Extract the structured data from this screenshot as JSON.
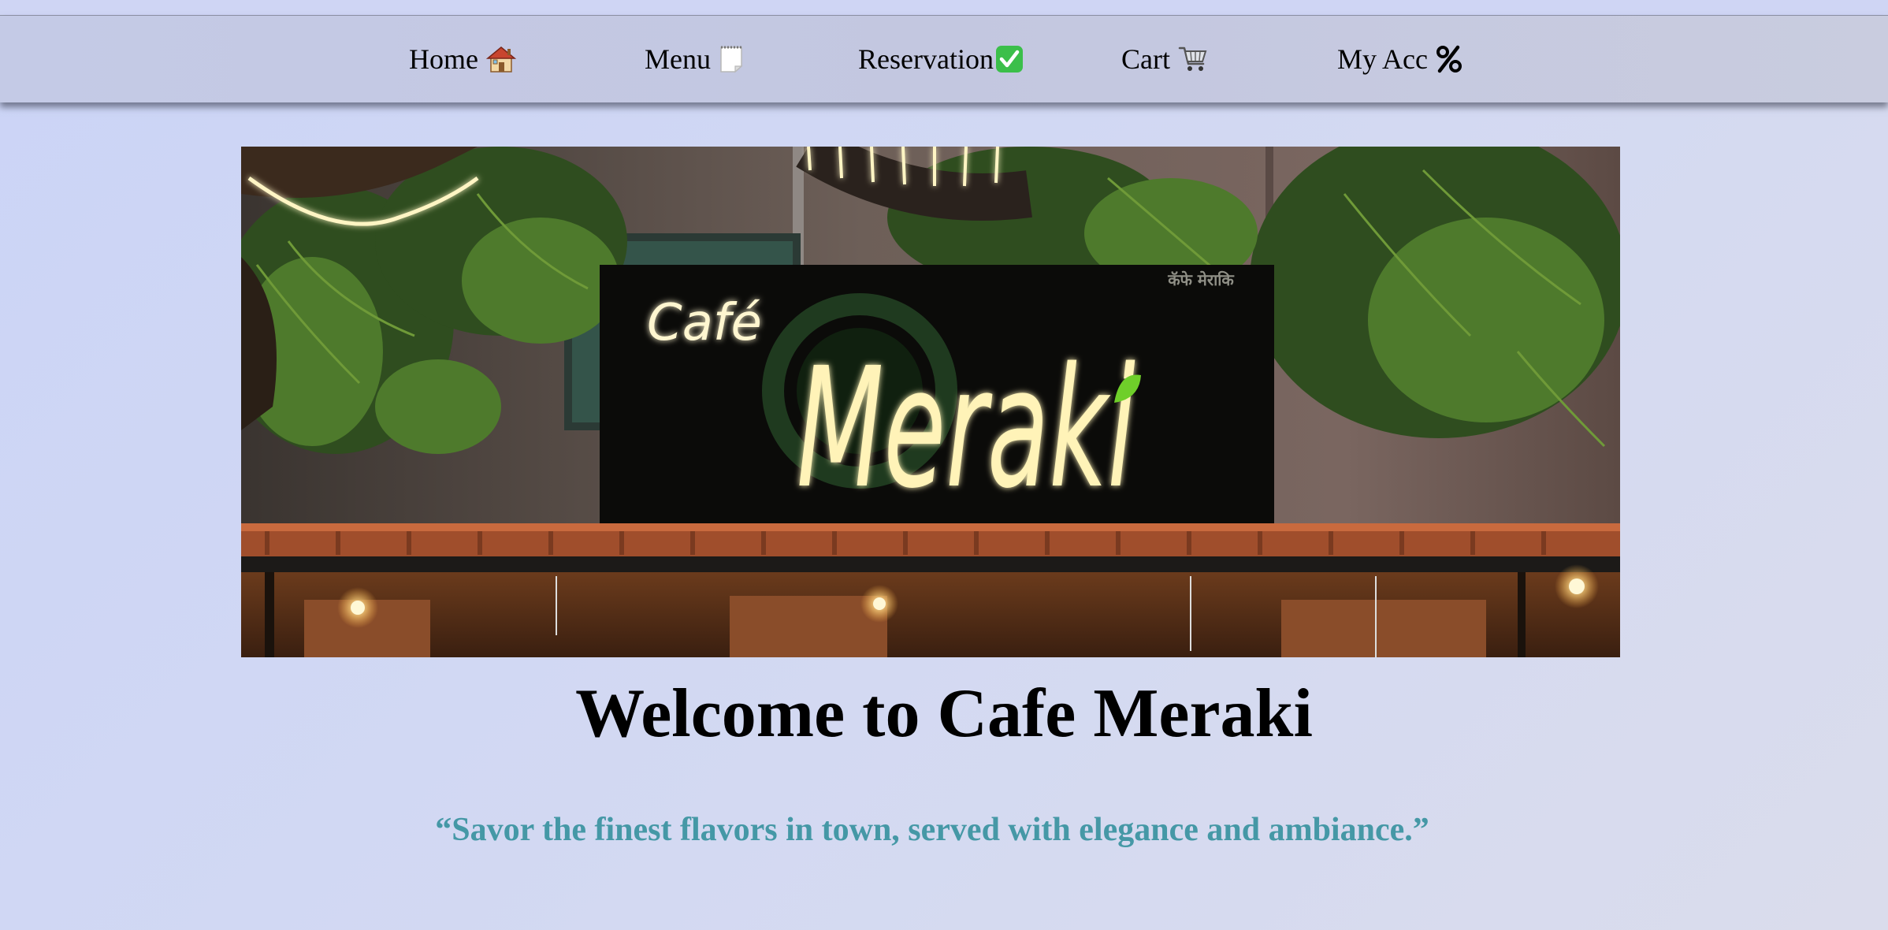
{
  "nav": {
    "items": [
      {
        "label": "Home",
        "icon": "house-icon"
      },
      {
        "label": "Menu",
        "icon": "notepad-icon"
      },
      {
        "label": "Reservation",
        "icon": "check-mark-icon"
      },
      {
        "label": "Cart",
        "icon": "shopping-cart-icon"
      },
      {
        "label": "My Acc",
        "icon": "percent-icon"
      }
    ]
  },
  "hero": {
    "sign_small": "Café",
    "sign_large": "Meraki",
    "sign_devanagari": "कॅफे मेराकि"
  },
  "welcome": {
    "heading": "Welcome to Cafe Meraki",
    "tagline": "“Savor the finest flavors in town, served with elegance and ambiance.”"
  },
  "colors": {
    "tagline": "#4598a6",
    "check": "#3bbf4a",
    "sign_glow": "#fff3b8"
  }
}
